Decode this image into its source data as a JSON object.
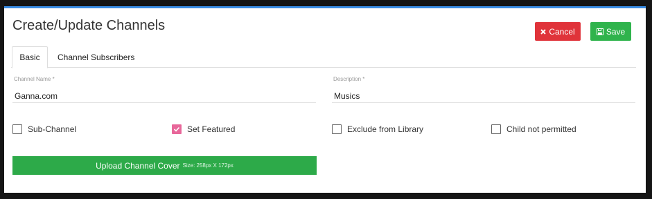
{
  "header": {
    "title": "Create/Update Channels",
    "cancel_label": "Cancel",
    "save_label": "Save"
  },
  "tabs": [
    {
      "label": "Basic",
      "active": true
    },
    {
      "label": "Channel Subscribers",
      "active": false
    }
  ],
  "form": {
    "channel_name": {
      "label": "Channel Name *",
      "value": "Ganna.com"
    },
    "description": {
      "label": "Description *",
      "value": "Musics"
    },
    "checkboxes": [
      {
        "label": "Sub-Channel",
        "checked": false
      },
      {
        "label": "Set Featured",
        "checked": true
      },
      {
        "label": "Exclude from Library",
        "checked": false
      },
      {
        "label": "Child not permitted",
        "checked": false
      }
    ],
    "upload": {
      "label": "Upload Channel Cover",
      "size_hint": "Size: 258px X 172px"
    }
  },
  "colors": {
    "cancel": "#e0333a",
    "save": "#2fb34c",
    "upload": "#2daa49",
    "checkbox_checked": "#e8679a",
    "top_border": "#3a8ee6"
  },
  "icons": {
    "cancel": "times-icon",
    "save": "floppy-disk-icon",
    "checked": "checkmark-icon"
  }
}
